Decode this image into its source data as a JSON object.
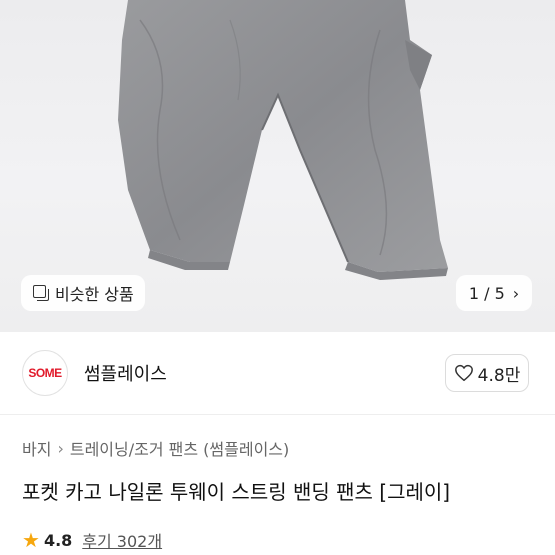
{
  "hero": {
    "similar_label": "비슷한 상품",
    "pager": {
      "current": "1",
      "separator": "/",
      "total": "5",
      "text": "1 / 5"
    }
  },
  "seller": {
    "logo_text": "SOME",
    "logo_color": "#e11a2b",
    "name": "썸플레이스",
    "likes": "4.8만"
  },
  "breadcrumb": [
    "바지",
    "트레이닝/조거 팬츠 (썸플레이스)"
  ],
  "product": {
    "title": "포켓 카고 나일론 투웨이 스트링 밴딩 팬츠 [그레이]",
    "rating": "4.8",
    "reviews": "후기 302개",
    "star_color": "#f6a70e"
  }
}
